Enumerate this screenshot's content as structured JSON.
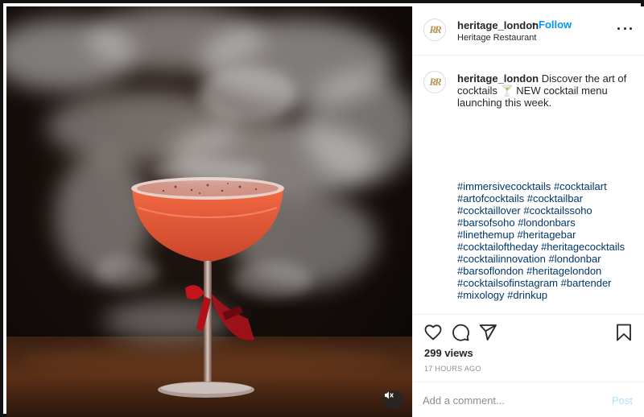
{
  "post": {
    "username": "heritage_london",
    "follow_label": "Follow",
    "follow_separator": "•",
    "location": "Heritage Restaurant",
    "avatar_initials": "RR",
    "caption": {
      "username": "heritage_london",
      "text": "Discover the art of cocktails 🍸 NEW cocktail menu launching this week."
    },
    "hashtag_lines": [
      [
        "#immersivecocktails",
        "#cocktailart"
      ],
      [
        "#artofcocktails",
        "#cocktailbar"
      ],
      [
        "#cocktaillover",
        "#cocktailssoho"
      ],
      [
        "#barsofsoho",
        "#londonbars"
      ],
      [
        "#linethemup",
        "#heritagebar"
      ],
      [
        "#cocktailoftheday",
        "#heritagecocktails"
      ],
      [
        "#cocktailinnovation",
        "#londonbar"
      ],
      [
        "#barsoflondon",
        "#heritagelondon"
      ],
      [
        "#cocktailsofinstagram",
        "#bartender"
      ],
      [
        "#mixology",
        "#drinkup"
      ]
    ],
    "views": "299 views",
    "timestamp": "17 HOURS AGO",
    "comment_placeholder": "Add a comment...",
    "post_label": "Post"
  },
  "icons": {
    "like": "heart-icon",
    "comment": "comment-icon",
    "share": "paper-plane-icon",
    "save": "bookmark-icon",
    "more": "more-options-icon",
    "mute": "speaker-muted-icon"
  },
  "colors": {
    "link_blue": "#0095f6",
    "hashtag": "#00376b",
    "post_disabled": "#b2dffc",
    "muted_text": "#8e8e8e",
    "avatar_gold": "#b8955a"
  }
}
